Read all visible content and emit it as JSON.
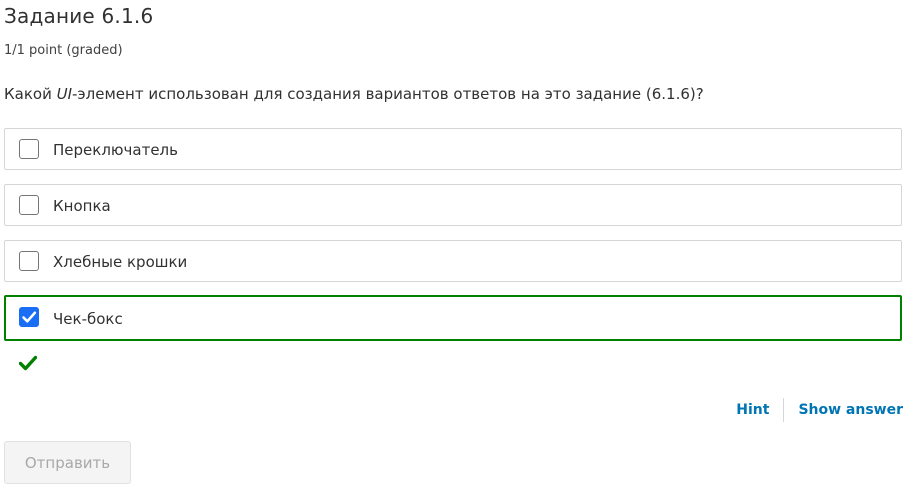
{
  "problem": {
    "title": "Задание 6.1.6",
    "score": "1/1 point (graded)",
    "question_before": "Какой ",
    "question_em": "UI",
    "question_after": "-элемент использован для создания вариантов ответов на это задание (6.1.6)?"
  },
  "options": [
    {
      "label": "Переключатель",
      "checked": false
    },
    {
      "label": "Кнопка",
      "checked": false
    },
    {
      "label": "Хлебные крошки",
      "checked": false
    },
    {
      "label": "Чек-бокс",
      "checked": true
    }
  ],
  "result": {
    "icon": "check-mark-icon",
    "status": "correct",
    "color": "#008100"
  },
  "actions": {
    "hint_label": "Hint",
    "show_answer_label": "Show answer"
  },
  "submit": {
    "label": "Отправить"
  },
  "colors": {
    "accent_link": "#0075b4",
    "correct_border": "#008100",
    "checkbox_checked": "#1a6ef5"
  }
}
